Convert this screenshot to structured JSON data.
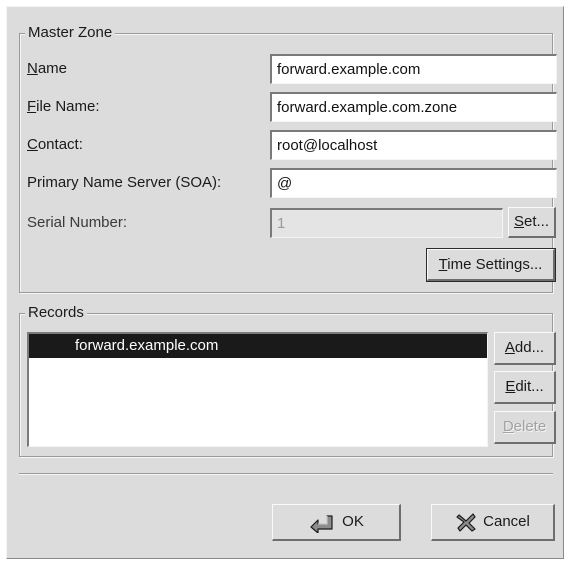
{
  "master_zone": {
    "title": "Master Zone",
    "name_label": "Name",
    "name_value": "forward.example.com",
    "file_name_label": "File Name:",
    "file_name_value": "forward.example.com.zone",
    "contact_label": "Contact:",
    "contact_value": "root@localhost",
    "primary_ns_label": "Primary Name Server (SOA):",
    "primary_ns_value": "@",
    "serial_label": "Serial Number:",
    "serial_value": "1",
    "set_button": "Set...",
    "time_settings_button": "Time Settings..."
  },
  "records": {
    "title": "Records",
    "items": [
      "forward.example.com"
    ],
    "add_button": "Add...",
    "edit_button": "Edit...",
    "delete_button": "Delete"
  },
  "footer": {
    "ok_label": "OK",
    "cancel_label": "Cancel"
  },
  "icons": {
    "ok": "ok-arrow-icon",
    "cancel": "cancel-x-icon"
  }
}
